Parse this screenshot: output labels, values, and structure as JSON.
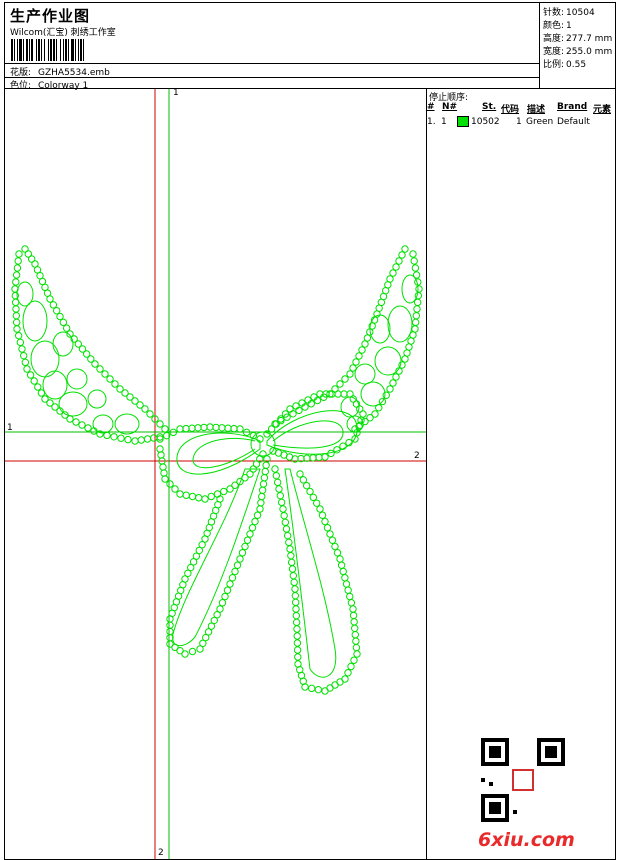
{
  "header": {
    "title": "生产作业图",
    "maker": "Wilcom(汇宝) 刺绣工作室",
    "design_label": "花版:",
    "design_value": "GZHA5534.emb",
    "colorway_label": "色位:",
    "colorway_value": "Colorway 1"
  },
  "stats": [
    {
      "label": "针数:",
      "value": "10504"
    },
    {
      "label": "颜色:",
      "value": "1"
    },
    {
      "label": "高度:",
      "value": "277.7 mm"
    },
    {
      "label": "宽度:",
      "value": "255.0 mm"
    },
    {
      "label": "比例:",
      "value": "0.55"
    }
  ],
  "stop_sequence": {
    "title": "停止顺序:",
    "headers": [
      "#",
      "N#",
      "St.",
      "代码",
      "描述",
      "Brand",
      "元素"
    ],
    "rows": [
      {
        "num": "1.",
        "n": "1",
        "swatch_color": "#00e000",
        "code": "10502",
        "st": "1",
        "desc": "Green",
        "brand": "Default"
      }
    ]
  },
  "axis_labels": {
    "v1": "1",
    "h1": "1",
    "h2": "2",
    "v2": "2"
  },
  "guide_colors": {
    "red": "#d00000",
    "green": "#00c000"
  },
  "stitch_color": "#00e000",
  "watermark": "6xiu.com"
}
